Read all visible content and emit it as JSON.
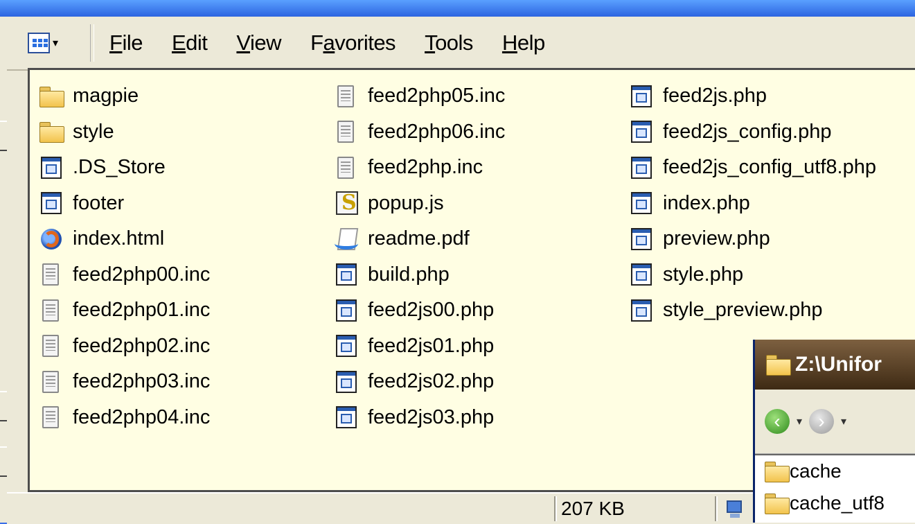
{
  "menu": {
    "items": [
      {
        "before": "",
        "accel": "F",
        "after": "ile"
      },
      {
        "before": "",
        "accel": "E",
        "after": "dit"
      },
      {
        "before": "",
        "accel": "V",
        "after": "iew"
      },
      {
        "before": "F",
        "accel": "a",
        "after": "vorites"
      },
      {
        "before": "",
        "accel": "T",
        "after": "ools"
      },
      {
        "before": "",
        "accel": "H",
        "after": "elp"
      }
    ]
  },
  "files": {
    "col1": [
      {
        "name": "magpie",
        "icon": "folder-icon"
      },
      {
        "name": "style",
        "icon": "folder-icon"
      },
      {
        "name": ".DS_Store",
        "icon": "application-file-icon"
      },
      {
        "name": "footer",
        "icon": "application-file-icon"
      },
      {
        "name": "index.html",
        "icon": "firefox-html-icon"
      },
      {
        "name": "feed2php00.inc",
        "icon": "text-document-icon"
      },
      {
        "name": "feed2php01.inc",
        "icon": "text-document-icon"
      },
      {
        "name": "feed2php02.inc",
        "icon": "text-document-icon"
      },
      {
        "name": "feed2php03.inc",
        "icon": "text-document-icon"
      },
      {
        "name": "feed2php04.inc",
        "icon": "text-document-icon"
      }
    ],
    "col2": [
      {
        "name": "feed2php05.inc",
        "icon": "text-document-icon"
      },
      {
        "name": "feed2php06.inc",
        "icon": "text-document-icon"
      },
      {
        "name": "feed2php.inc",
        "icon": "text-document-icon"
      },
      {
        "name": "popup.js",
        "icon": "javascript-file-icon"
      },
      {
        "name": "readme.pdf",
        "icon": "pdf-file-icon"
      },
      {
        "name": "build.php",
        "icon": "application-file-icon"
      },
      {
        "name": "feed2js00.php",
        "icon": "application-file-icon"
      },
      {
        "name": "feed2js01.php",
        "icon": "application-file-icon"
      },
      {
        "name": "feed2js02.php",
        "icon": "application-file-icon"
      },
      {
        "name": "feed2js03.php",
        "icon": "application-file-icon"
      }
    ],
    "col3": [
      {
        "name": "feed2js.php",
        "icon": "application-file-icon"
      },
      {
        "name": "feed2js_config.php",
        "icon": "application-file-icon"
      },
      {
        "name": "feed2js_config_utf8.php",
        "icon": "application-file-icon"
      },
      {
        "name": "index.php",
        "icon": "application-file-icon"
      },
      {
        "name": "preview.php",
        "icon": "application-file-icon"
      },
      {
        "name": "style.php",
        "icon": "application-file-icon"
      },
      {
        "name": "style_preview.php",
        "icon": "application-file-icon"
      }
    ]
  },
  "status": {
    "size": "207 KB"
  },
  "popup": {
    "title": "Z:\\Unifor",
    "items": [
      {
        "name": "cache",
        "icon": "folder-icon"
      },
      {
        "name": "cache_utf8",
        "icon": "folder-icon"
      }
    ]
  },
  "colors": {
    "desktop_blue": "#3a6ee8",
    "window_chrome": "#ece9d8",
    "list_background": "#fffee3"
  }
}
